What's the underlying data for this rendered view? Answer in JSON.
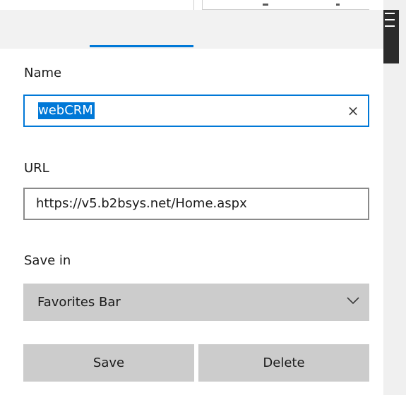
{
  "tabs": [
    {
      "label": "",
      "active": false
    },
    {
      "label": "",
      "active": true
    }
  ],
  "form": {
    "name_label": "Name",
    "name_value": "webCRM",
    "clear_glyph": "×",
    "url_label": "URL",
    "url_value": "https://v5.b2bsys.net/Home.aspx",
    "save_in_label": "Save in",
    "save_in_value": "Favorites Bar"
  },
  "buttons": {
    "save_label": "Save",
    "delete_label": "Delete"
  },
  "icons": {
    "menu": "hamburger-menu-icon",
    "clear": "close-icon",
    "dropdown": "chevron-down-icon"
  },
  "colors": {
    "accent": "#0078d7",
    "button_bg": "#cccccc",
    "tab_bar_bg": "#f2f2f2",
    "scroll_thumb": "#2b2b2b"
  }
}
